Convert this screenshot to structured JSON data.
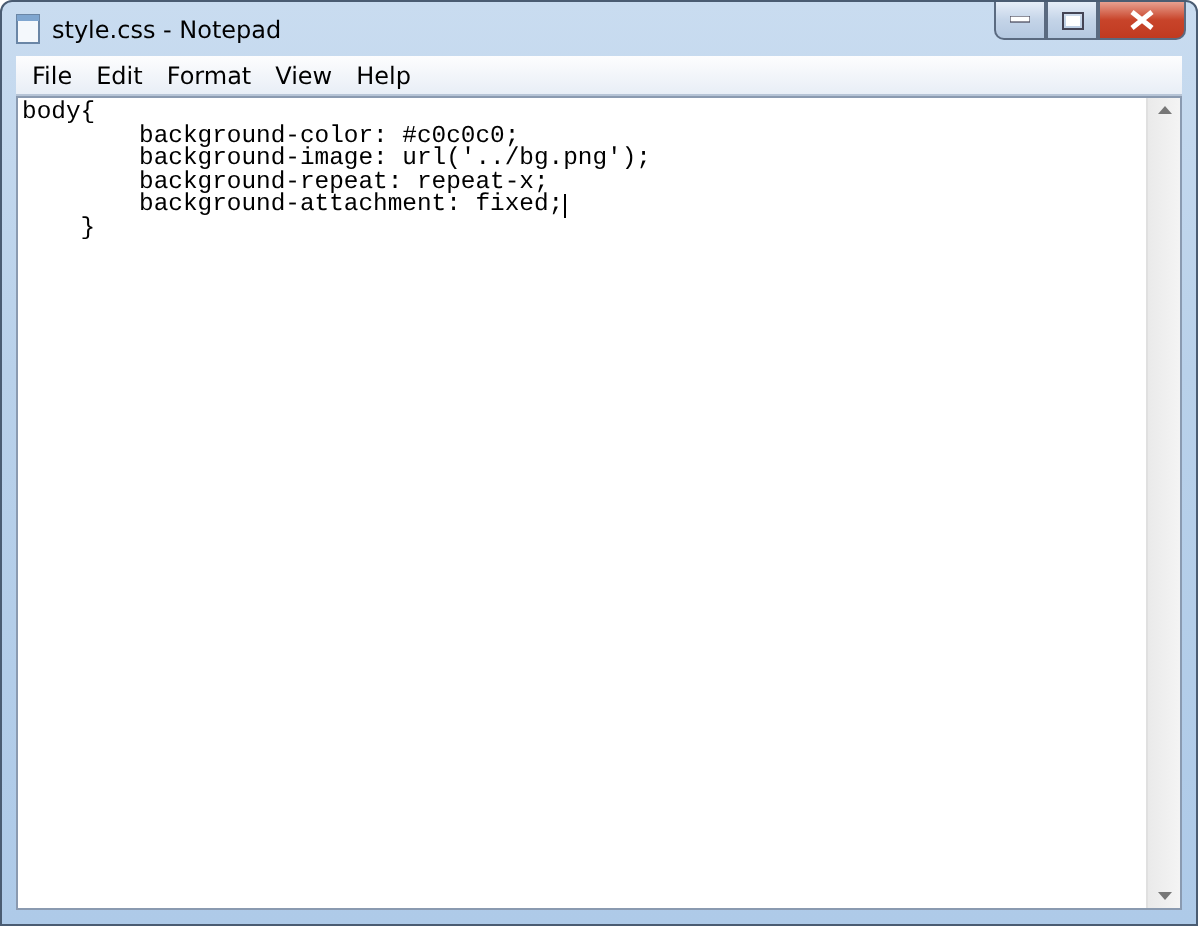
{
  "window": {
    "title": "style.css - Notepad"
  },
  "menu": [
    {
      "label": "File"
    },
    {
      "label": "Edit"
    },
    {
      "label": "Format"
    },
    {
      "label": "View"
    },
    {
      "label": "Help"
    }
  ],
  "editor": {
    "lines": [
      "body{",
      "        background-color: #c0c0c0;",
      "        background-image: url('../bg.png');",
      "        background-repeat: repeat-x;",
      "        background-attachment: fixed;",
      "    }"
    ]
  }
}
